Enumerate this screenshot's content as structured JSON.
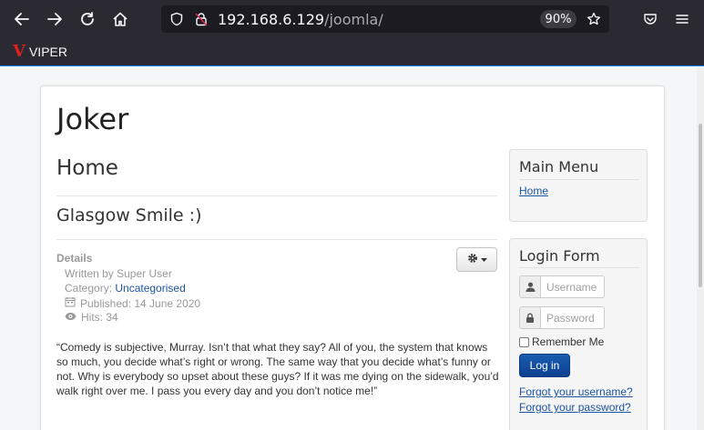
{
  "browser": {
    "url_host": "192.168.6.129",
    "url_path": "/joomla/",
    "zoom": "90%",
    "bookmark_label": "VIPER",
    "bookmark_logo": "V"
  },
  "site": {
    "title": "Joker"
  },
  "main": {
    "page_heading": "Home",
    "article_title": "Glasgow Smile :)",
    "details_label": "Details",
    "written_by": "Written by Super User",
    "category_prefix": "Category: ",
    "category": "Uncategorised",
    "published": "Published: 14 June 2020",
    "hits": "Hits: 34",
    "body": "“Comedy is subjective, Murray. Isn’t that what they say? All of you, the system that knows so much, you decide what’s right or wrong. The same way that you decide what’s funny or not. Why is everybody so upset about these guys? If it was me dying on the sidewalk, you’d walk right over me. I pass you every day and you don’t notice me!”"
  },
  "sidebar": {
    "main_menu": {
      "title": "Main Menu",
      "items": [
        "Home"
      ]
    },
    "login": {
      "title": "Login Form",
      "username_placeholder": "Username",
      "password_placeholder": "Password",
      "remember_label": "Remember Me",
      "login_button": "Log in",
      "forgot_username": "Forgot your username?",
      "forgot_password": "Forgot your password?"
    }
  }
}
